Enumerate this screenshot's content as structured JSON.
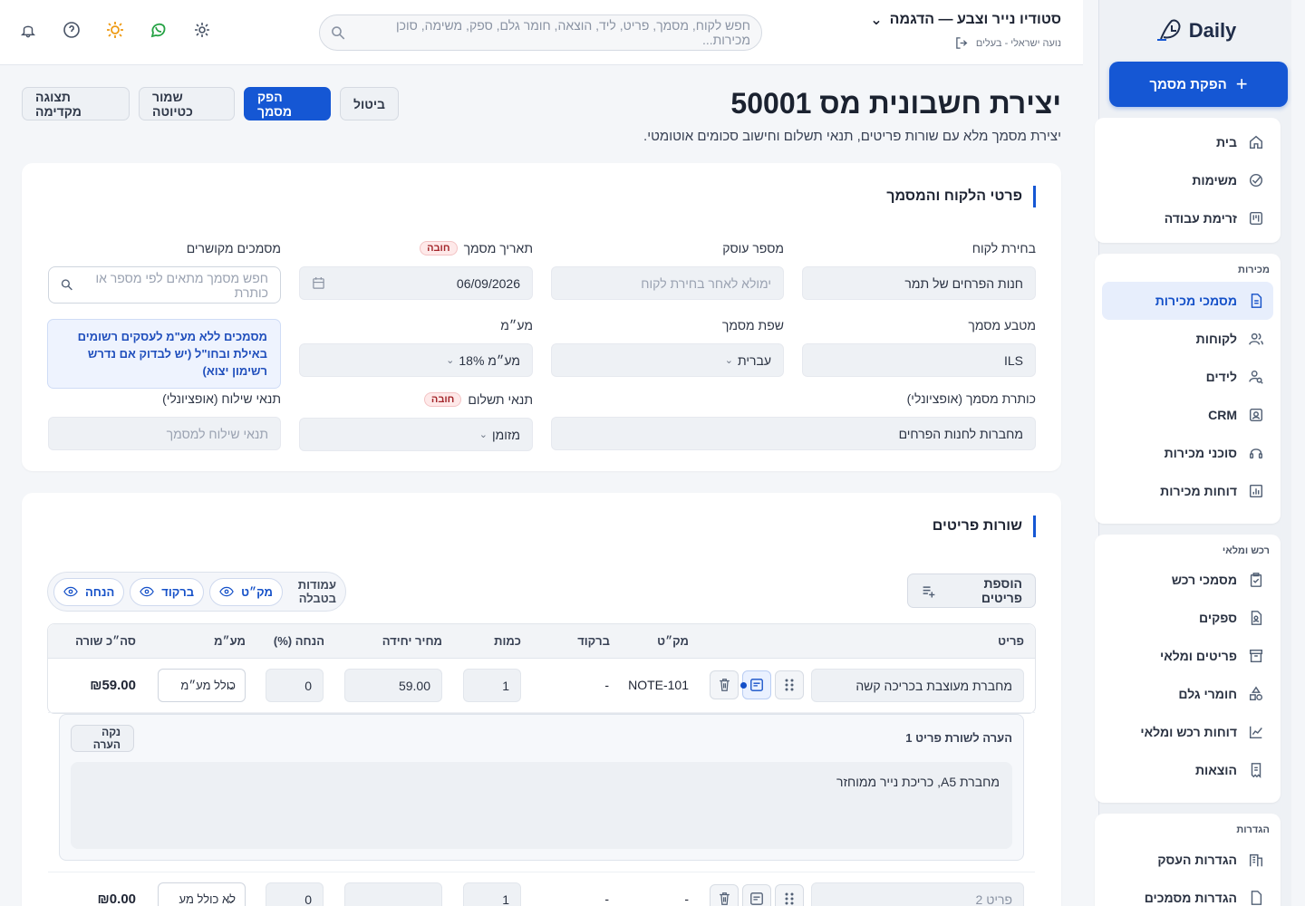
{
  "brand": {
    "logo_text": "Daily"
  },
  "sidebar": {
    "new_button": "הפקת מסמך",
    "groups": [
      {
        "title": "",
        "items": [
          {
            "label": "בית",
            "icon": "home-icon"
          },
          {
            "label": "משימות",
            "icon": "check-circle-icon"
          },
          {
            "label": "זרימת עבודה",
            "icon": "kanban-icon"
          }
        ]
      },
      {
        "title": "מכירות",
        "items": [
          {
            "label": "מסמכי מכירות",
            "icon": "document-icon",
            "active": true
          },
          {
            "label": "לקוחות",
            "icon": "users-icon"
          },
          {
            "label": "לידים",
            "icon": "user-search-icon"
          },
          {
            "label": "CRM",
            "icon": "contact-card-icon"
          },
          {
            "label": "סוכני מכירות",
            "icon": "headset-icon"
          },
          {
            "label": "דוחות מכירות",
            "icon": "bar-report-icon"
          }
        ]
      },
      {
        "title": "רכש ומלאי",
        "items": [
          {
            "label": "מסמכי רכש",
            "icon": "clipboard-check-icon"
          },
          {
            "label": "ספקים",
            "icon": "file-user-icon"
          },
          {
            "label": "פריטים ומלאי",
            "icon": "archive-box-icon"
          },
          {
            "label": "חומרי גלם",
            "icon": "shapes-icon"
          },
          {
            "label": "דוחות רכש ומלאי",
            "icon": "line-chart-icon"
          },
          {
            "label": "הוצאות",
            "icon": "receipt-icon"
          }
        ]
      },
      {
        "title": "הגדרות",
        "items": [
          {
            "label": "הגדרות העסק",
            "icon": "building-icon"
          },
          {
            "label": "הגדרות מסמכים",
            "icon": "document-settings-icon"
          }
        ]
      }
    ]
  },
  "header": {
    "org_name": "סטודיו נייר וצבע — הדגמה",
    "user": "נועה ישראלי - בעלים",
    "search_placeholder": "חפש לקוח, מסמך, פריט, ליד, הוצאה, חומר גלם, ספק, משימה, סוכן מכירות..."
  },
  "page": {
    "title": "יצירת חשבונית מס 50001",
    "subtitle": "יצירת מסמך מלא עם שורות פריטים, תנאי תשלום וחישוב סכומים אוטומטי.",
    "actions": {
      "cancel": "ביטול",
      "issue": "הפק מסמך",
      "save_draft": "שמור כטיוטה",
      "preview": "תצוגה מקדימה"
    }
  },
  "customer_card": {
    "title": "פרטי הלקוח והמסמך",
    "required_badge": "חובה",
    "fields": {
      "customer": {
        "label": "בחירת לקוח",
        "value": "חנות הפרחים של תמר"
      },
      "business_number": {
        "label": "מספר עוסק",
        "placeholder": "ימולא לאחר בחירת לקוח"
      },
      "doc_date": {
        "label": "תאריך מסמך",
        "value": "06/09/2026"
      },
      "related_docs": {
        "label": "מסמכים מקושרים",
        "placeholder": "חפש מסמך מתאים לפי מספר או כותרת"
      },
      "currency": {
        "label": "מטבע מסמך",
        "value": "ILS"
      },
      "language": {
        "label": "שפת מסמך",
        "value": "עברית"
      },
      "vat": {
        "label": "מע״מ",
        "value": "מע״מ 18%"
      },
      "doc_title": {
        "label": "כותרת מסמך (אופציונלי)",
        "value": "מחברות לחנות הפרחים"
      },
      "payment_terms": {
        "label": "תנאי תשלום",
        "value": "מזומן"
      },
      "shipping_terms": {
        "label": "תנאי שילוח (אופציונלי)",
        "placeholder": "תנאי שילוח למסמך"
      }
    },
    "info": "מסמכים ללא מע\"מ לעסקים רשומים באילת ובחו\"ל (יש לבדוק אם נדרש רשימון יצוא)"
  },
  "items_card": {
    "title": "שורות פריטים",
    "add_button": "הוספת פריטים",
    "columns_label": "עמודות בטבלה",
    "chips": [
      "מק״ט",
      "ברקוד",
      "הנחה"
    ],
    "headers": [
      "פריט",
      "מק״ט",
      "ברקוד",
      "כמות",
      "מחיר יחידה",
      "הנחה (%)",
      "מע״מ",
      "סה״כ שורה"
    ],
    "rows": [
      {
        "item": "מחברת מעוצבת בכריכה קשה",
        "sku": "NOTE-101",
        "barcode": "-",
        "qty": "1",
        "price": "59.00",
        "discount": "0",
        "vat": "כולל מע״מ",
        "total": "₪59.00"
      },
      {
        "item": "",
        "item_placeholder": "פריט 2",
        "sku": "-",
        "barcode": "-",
        "qty": "1",
        "price": "",
        "discount": "0",
        "vat": "לא כולל מע",
        "total": "₪0.00"
      }
    ],
    "note": {
      "title": "הערה לשורת פריט 1",
      "clear": "נקה הערה",
      "text": "מחברת A5, כריכת נייר ממוחזר"
    }
  },
  "colors": {
    "primary": "#1557d4",
    "danger": "#a3262b",
    "whatsapp": "#25a244",
    "sun": "#ee9a13"
  }
}
